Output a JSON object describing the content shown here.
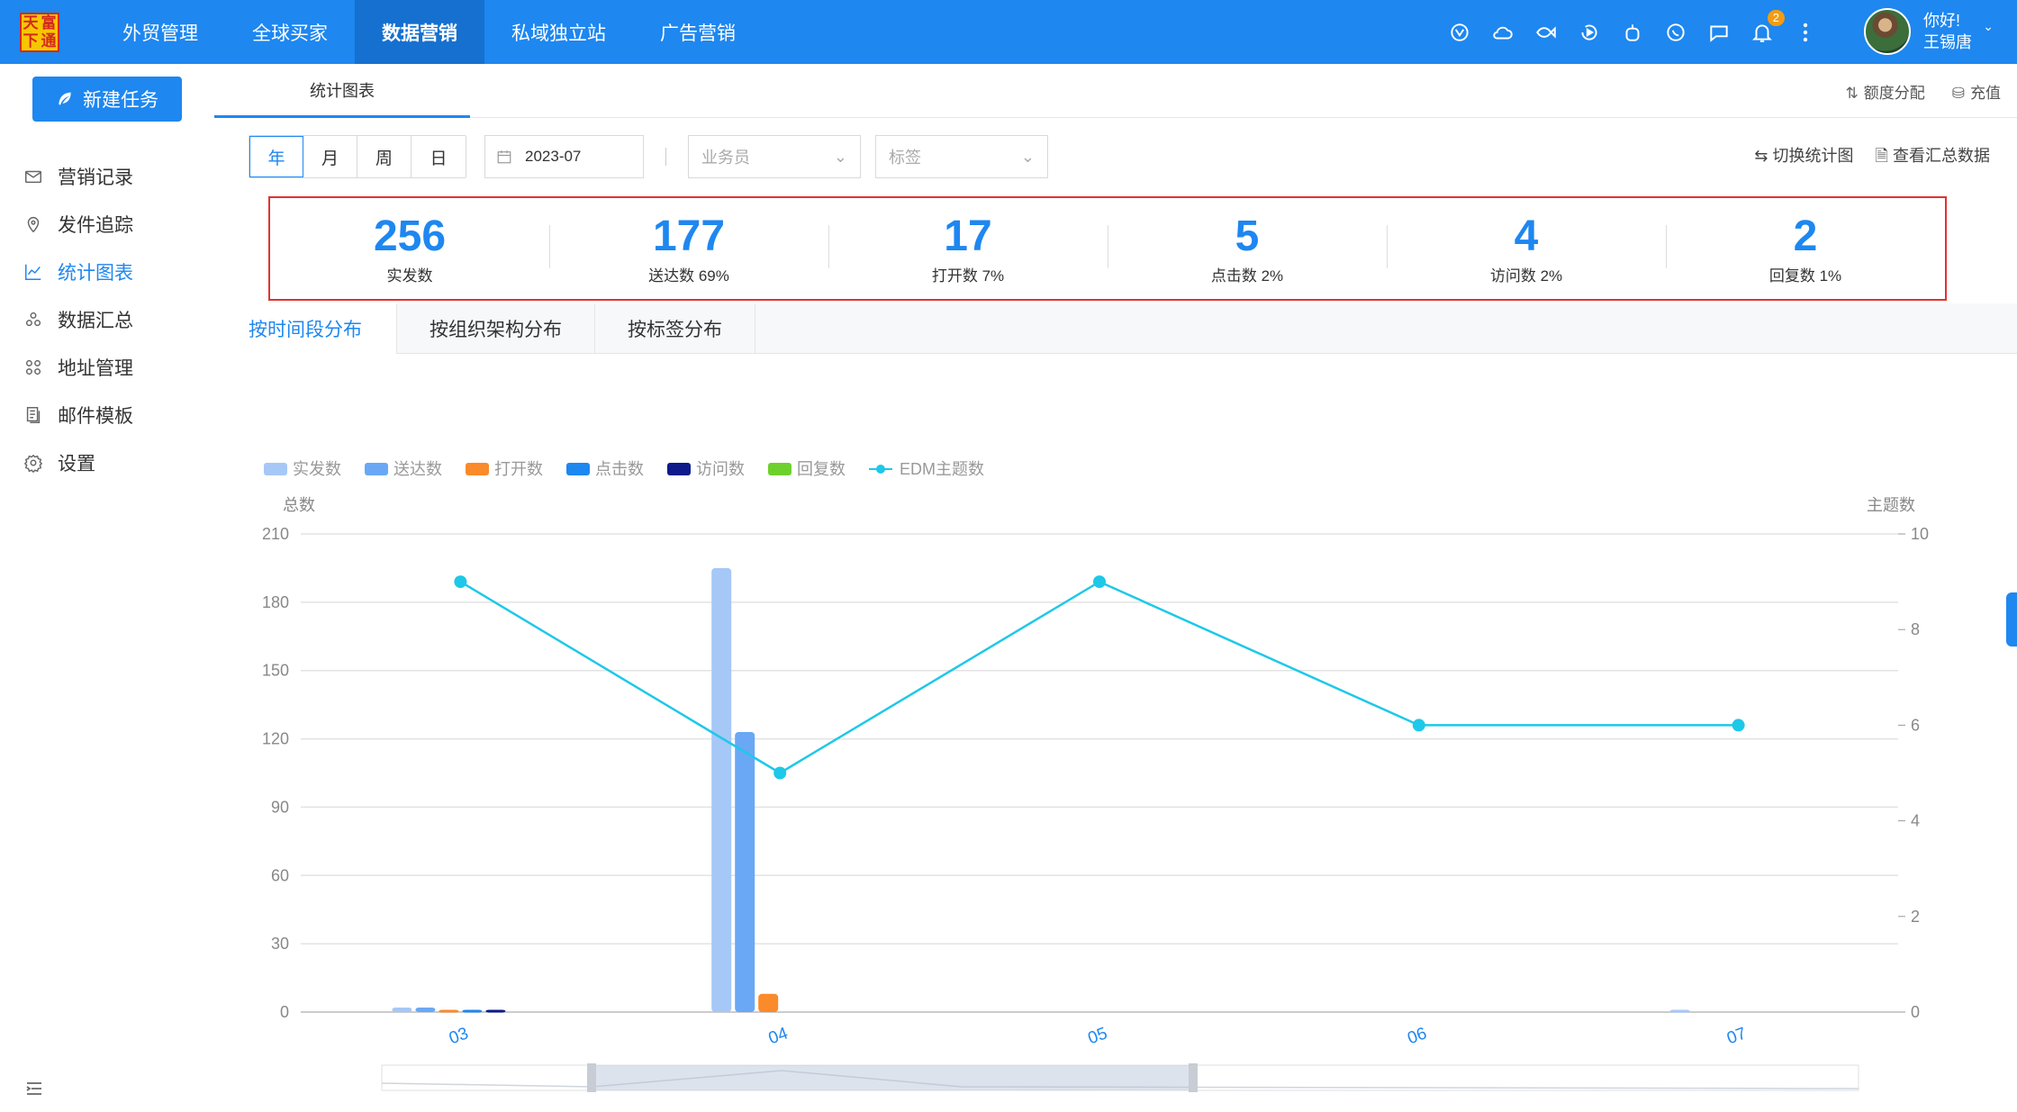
{
  "logo": {
    "chars": [
      "天",
      "富",
      "下",
      "通"
    ]
  },
  "nav": [
    {
      "label": "外贸管理",
      "active": false
    },
    {
      "label": "全球买家",
      "active": false
    },
    {
      "label": "数据营销",
      "active": true
    },
    {
      "label": "私域独立站",
      "active": false
    },
    {
      "label": "广告营销",
      "active": false
    }
  ],
  "notifications": {
    "count": "2"
  },
  "user": {
    "greeting": "你好!",
    "name": "王锡唐"
  },
  "sidebar": {
    "new_task": "新建任务",
    "items": [
      {
        "label": "营销记录",
        "icon": "mail-icon",
        "active": false
      },
      {
        "label": "发件追踪",
        "icon": "location-pin-icon",
        "active": false
      },
      {
        "label": "统计图表",
        "icon": "line-chart-icon",
        "active": true
      },
      {
        "label": "数据汇总",
        "icon": "cluster-icon",
        "active": false
      },
      {
        "label": "地址管理",
        "icon": "grid-icon",
        "active": false
      },
      {
        "label": "邮件模板",
        "icon": "template-icon",
        "active": false
      },
      {
        "label": "设置",
        "icon": "gear-icon",
        "active": false
      }
    ]
  },
  "tabbar": {
    "active_tab": "统计图表",
    "quota": "额度分配",
    "recharge": "充值"
  },
  "filters": {
    "periods": [
      "年",
      "月",
      "周",
      "日"
    ],
    "active_period": "年",
    "date_value": "2023-07",
    "salesperson_placeholder": "业务员",
    "tag_placeholder": "标签",
    "switch_chart": "切换统计图",
    "view_summary": "查看汇总数据"
  },
  "kpis": [
    {
      "value": "256",
      "label": "实发数"
    },
    {
      "value": "177",
      "label": "送达数 69%"
    },
    {
      "value": "17",
      "label": "打开数 7%"
    },
    {
      "value": "5",
      "label": "点击数 2%"
    },
    {
      "value": "4",
      "label": "访问数 2%"
    },
    {
      "value": "2",
      "label": "回复数 1%"
    }
  ],
  "subtabs": [
    {
      "label": "按时间段分布",
      "active": true
    },
    {
      "label": "按组织架构分布",
      "active": false
    },
    {
      "label": "按标签分布",
      "active": false
    }
  ],
  "chart_data": {
    "type": "bar",
    "categories": [
      "03",
      "04",
      "05",
      "06",
      "07"
    ],
    "ylabel": "总数",
    "ylabel_right": "主题数",
    "ylim": [
      0,
      210
    ],
    "yticks": [
      0,
      30,
      60,
      90,
      120,
      150,
      180,
      210
    ],
    "ylim_right": [
      0,
      10
    ],
    "yticks_right": [
      0,
      2,
      4,
      6,
      8,
      10
    ],
    "legend_position": "top-left",
    "series": [
      {
        "name": "实发数",
        "color": "#a6c8f7",
        "values": [
          2,
          195,
          0,
          0,
          1
        ]
      },
      {
        "name": "送达数",
        "color": "#6aa8f5",
        "values": [
          2,
          123,
          0,
          0,
          0
        ]
      },
      {
        "name": "打开数",
        "color": "#fa8a2a",
        "values": [
          1,
          8,
          0,
          0,
          0
        ]
      },
      {
        "name": "点击数",
        "color": "#1e87f0",
        "values": [
          1,
          0,
          0,
          0,
          0
        ]
      },
      {
        "name": "访问数",
        "color": "#0c1a8a",
        "values": [
          1,
          0,
          0,
          0,
          0
        ]
      },
      {
        "name": "回复数",
        "color": "#6dd12d",
        "values": [
          0,
          0,
          0,
          0,
          0
        ]
      }
    ],
    "line_series": {
      "name": "EDM主题数",
      "color": "#1ec8e8",
      "axis": "right",
      "values": [
        9,
        5,
        9,
        6,
        6
      ]
    }
  }
}
